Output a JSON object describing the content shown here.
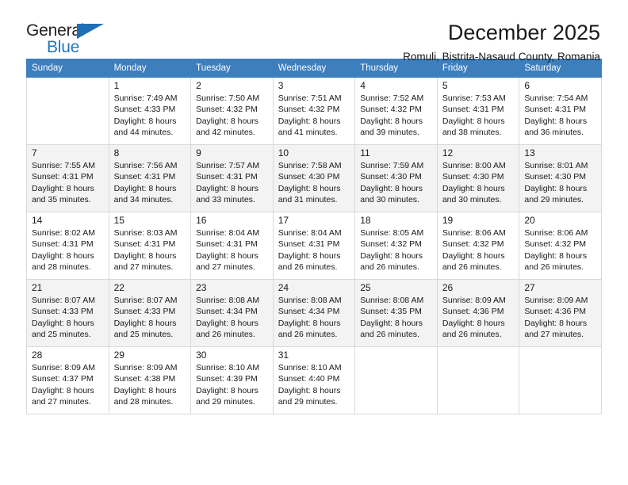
{
  "brand": {
    "name_top": "General",
    "name_bottom": "Blue",
    "color_dark": "#231f20",
    "color_blue": "#1f78c1",
    "triangle_icon": "triangle-icon"
  },
  "header": {
    "title": "December 2025",
    "subtitle": "Romuli, Bistrita-Nasaud County, Romania"
  },
  "theme": {
    "header_bg": "#3d7ebd",
    "header_text": "#ffffff",
    "grid_border": "#d9d9d9",
    "alt_row_bg": "#f3f3f3",
    "cell_bg": "#ffffff"
  },
  "weekday_headers": [
    "Sunday",
    "Monday",
    "Tuesday",
    "Wednesday",
    "Thursday",
    "Friday",
    "Saturday"
  ],
  "labels": {
    "sunrise_prefix": "Sunrise:",
    "sunset_prefix": "Sunset:",
    "daylight_prefix": "Daylight:"
  },
  "weeks": [
    {
      "alt": false,
      "days": [
        {
          "empty": true,
          "num": "",
          "line1": "",
          "line2": "",
          "line3": "",
          "line4": ""
        },
        {
          "empty": false,
          "num": "1",
          "line1": "Sunrise: 7:49 AM",
          "line2": "Sunset: 4:33 PM",
          "line3": "Daylight: 8 hours",
          "line4": "and 44 minutes."
        },
        {
          "empty": false,
          "num": "2",
          "line1": "Sunrise: 7:50 AM",
          "line2": "Sunset: 4:32 PM",
          "line3": "Daylight: 8 hours",
          "line4": "and 42 minutes."
        },
        {
          "empty": false,
          "num": "3",
          "line1": "Sunrise: 7:51 AM",
          "line2": "Sunset: 4:32 PM",
          "line3": "Daylight: 8 hours",
          "line4": "and 41 minutes."
        },
        {
          "empty": false,
          "num": "4",
          "line1": "Sunrise: 7:52 AM",
          "line2": "Sunset: 4:32 PM",
          "line3": "Daylight: 8 hours",
          "line4": "and 39 minutes."
        },
        {
          "empty": false,
          "num": "5",
          "line1": "Sunrise: 7:53 AM",
          "line2": "Sunset: 4:31 PM",
          "line3": "Daylight: 8 hours",
          "line4": "and 38 minutes."
        },
        {
          "empty": false,
          "num": "6",
          "line1": "Sunrise: 7:54 AM",
          "line2": "Sunset: 4:31 PM",
          "line3": "Daylight: 8 hours",
          "line4": "and 36 minutes."
        }
      ]
    },
    {
      "alt": true,
      "days": [
        {
          "empty": false,
          "num": "7",
          "line1": "Sunrise: 7:55 AM",
          "line2": "Sunset: 4:31 PM",
          "line3": "Daylight: 8 hours",
          "line4": "and 35 minutes."
        },
        {
          "empty": false,
          "num": "8",
          "line1": "Sunrise: 7:56 AM",
          "line2": "Sunset: 4:31 PM",
          "line3": "Daylight: 8 hours",
          "line4": "and 34 minutes."
        },
        {
          "empty": false,
          "num": "9",
          "line1": "Sunrise: 7:57 AM",
          "line2": "Sunset: 4:31 PM",
          "line3": "Daylight: 8 hours",
          "line4": "and 33 minutes."
        },
        {
          "empty": false,
          "num": "10",
          "line1": "Sunrise: 7:58 AM",
          "line2": "Sunset: 4:30 PM",
          "line3": "Daylight: 8 hours",
          "line4": "and 31 minutes."
        },
        {
          "empty": false,
          "num": "11",
          "line1": "Sunrise: 7:59 AM",
          "line2": "Sunset: 4:30 PM",
          "line3": "Daylight: 8 hours",
          "line4": "and 30 minutes."
        },
        {
          "empty": false,
          "num": "12",
          "line1": "Sunrise: 8:00 AM",
          "line2": "Sunset: 4:30 PM",
          "line3": "Daylight: 8 hours",
          "line4": "and 30 minutes."
        },
        {
          "empty": false,
          "num": "13",
          "line1": "Sunrise: 8:01 AM",
          "line2": "Sunset: 4:30 PM",
          "line3": "Daylight: 8 hours",
          "line4": "and 29 minutes."
        }
      ]
    },
    {
      "alt": false,
      "days": [
        {
          "empty": false,
          "num": "14",
          "line1": "Sunrise: 8:02 AM",
          "line2": "Sunset: 4:31 PM",
          "line3": "Daylight: 8 hours",
          "line4": "and 28 minutes."
        },
        {
          "empty": false,
          "num": "15",
          "line1": "Sunrise: 8:03 AM",
          "line2": "Sunset: 4:31 PM",
          "line3": "Daylight: 8 hours",
          "line4": "and 27 minutes."
        },
        {
          "empty": false,
          "num": "16",
          "line1": "Sunrise: 8:04 AM",
          "line2": "Sunset: 4:31 PM",
          "line3": "Daylight: 8 hours",
          "line4": "and 27 minutes."
        },
        {
          "empty": false,
          "num": "17",
          "line1": "Sunrise: 8:04 AM",
          "line2": "Sunset: 4:31 PM",
          "line3": "Daylight: 8 hours",
          "line4": "and 26 minutes."
        },
        {
          "empty": false,
          "num": "18",
          "line1": "Sunrise: 8:05 AM",
          "line2": "Sunset: 4:32 PM",
          "line3": "Daylight: 8 hours",
          "line4": "and 26 minutes."
        },
        {
          "empty": false,
          "num": "19",
          "line1": "Sunrise: 8:06 AM",
          "line2": "Sunset: 4:32 PM",
          "line3": "Daylight: 8 hours",
          "line4": "and 26 minutes."
        },
        {
          "empty": false,
          "num": "20",
          "line1": "Sunrise: 8:06 AM",
          "line2": "Sunset: 4:32 PM",
          "line3": "Daylight: 8 hours",
          "line4": "and 26 minutes."
        }
      ]
    },
    {
      "alt": true,
      "days": [
        {
          "empty": false,
          "num": "21",
          "line1": "Sunrise: 8:07 AM",
          "line2": "Sunset: 4:33 PM",
          "line3": "Daylight: 8 hours",
          "line4": "and 25 minutes."
        },
        {
          "empty": false,
          "num": "22",
          "line1": "Sunrise: 8:07 AM",
          "line2": "Sunset: 4:33 PM",
          "line3": "Daylight: 8 hours",
          "line4": "and 25 minutes."
        },
        {
          "empty": false,
          "num": "23",
          "line1": "Sunrise: 8:08 AM",
          "line2": "Sunset: 4:34 PM",
          "line3": "Daylight: 8 hours",
          "line4": "and 26 minutes."
        },
        {
          "empty": false,
          "num": "24",
          "line1": "Sunrise: 8:08 AM",
          "line2": "Sunset: 4:34 PM",
          "line3": "Daylight: 8 hours",
          "line4": "and 26 minutes."
        },
        {
          "empty": false,
          "num": "25",
          "line1": "Sunrise: 8:08 AM",
          "line2": "Sunset: 4:35 PM",
          "line3": "Daylight: 8 hours",
          "line4": "and 26 minutes."
        },
        {
          "empty": false,
          "num": "26",
          "line1": "Sunrise: 8:09 AM",
          "line2": "Sunset: 4:36 PM",
          "line3": "Daylight: 8 hours",
          "line4": "and 26 minutes."
        },
        {
          "empty": false,
          "num": "27",
          "line1": "Sunrise: 8:09 AM",
          "line2": "Sunset: 4:36 PM",
          "line3": "Daylight: 8 hours",
          "line4": "and 27 minutes."
        }
      ]
    },
    {
      "alt": false,
      "days": [
        {
          "empty": false,
          "num": "28",
          "line1": "Sunrise: 8:09 AM",
          "line2": "Sunset: 4:37 PM",
          "line3": "Daylight: 8 hours",
          "line4": "and 27 minutes."
        },
        {
          "empty": false,
          "num": "29",
          "line1": "Sunrise: 8:09 AM",
          "line2": "Sunset: 4:38 PM",
          "line3": "Daylight: 8 hours",
          "line4": "and 28 minutes."
        },
        {
          "empty": false,
          "num": "30",
          "line1": "Sunrise: 8:10 AM",
          "line2": "Sunset: 4:39 PM",
          "line3": "Daylight: 8 hours",
          "line4": "and 29 minutes."
        },
        {
          "empty": false,
          "num": "31",
          "line1": "Sunrise: 8:10 AM",
          "line2": "Sunset: 4:40 PM",
          "line3": "Daylight: 8 hours",
          "line4": "and 29 minutes."
        },
        {
          "empty": true,
          "num": "",
          "line1": "",
          "line2": "",
          "line3": "",
          "line4": ""
        },
        {
          "empty": true,
          "num": "",
          "line1": "",
          "line2": "",
          "line3": "",
          "line4": ""
        },
        {
          "empty": true,
          "num": "",
          "line1": "",
          "line2": "",
          "line3": "",
          "line4": ""
        }
      ]
    }
  ]
}
